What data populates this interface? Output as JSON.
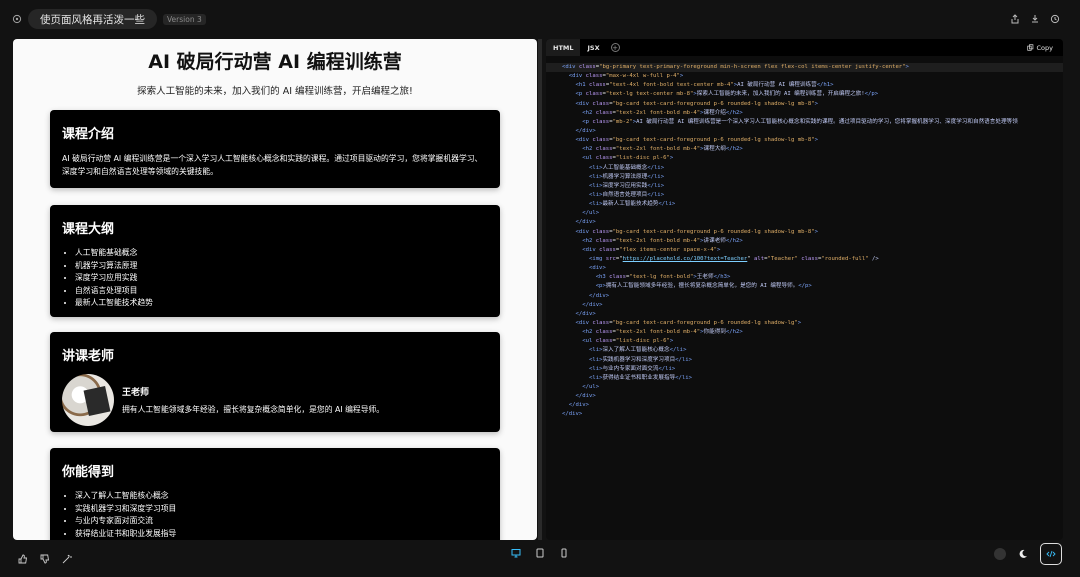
{
  "header": {
    "title": "使页面风格再活泼一些",
    "version": "Version 3"
  },
  "preview": {
    "title": "AI 破局行动营 AI 编程训练营",
    "subtitle": "探索人工智能的未来，加入我们的 AI 编程训练营，开启编程之旅!",
    "intro": {
      "heading": "课程介绍",
      "body": "AI 破局行动营 AI 编程训练营是一个深入学习人工智能核心概念和实践的课程。通过项目驱动的学习，您将掌握机器学习、深度学习和自然语言处理等领域的关键技能。"
    },
    "outline": {
      "heading": "课程大纲",
      "items": [
        "人工智能基础概念",
        "机器学习算法原理",
        "深度学习应用实践",
        "自然语言处理项目",
        "最新人工智能技术趋势"
      ]
    },
    "teacher": {
      "heading": "讲课老师",
      "name": "王老师",
      "bio": "拥有人工智能领域多年经验，擅长将复杂概念简单化，是您的 AI 编程导师。"
    },
    "gains": {
      "heading": "你能得到",
      "items": [
        "深入了解人工智能核心概念",
        "实践机器学习和深度学习项目",
        "与业内专家面对面交流",
        "获得结业证书和职业发展指导"
      ]
    }
  },
  "code": {
    "tabs": [
      "HTML",
      "JSX"
    ],
    "copy_label": "Copy",
    "lines": [
      "<div class=\"bg-primary text-primary-foreground min-h-screen flex flex-col items-center justify-center\">",
      "  <div class=\"max-w-4xl w-full p-4\">",
      "    <h1 class=\"text-4xl font-bold text-center mb-4\">AI 破局行动营 AI 编程训练营</h1>",
      "    <p class=\"text-lg text-center mb-8\">探索人工智能的未来，加入我们的 AI 编程训练营，开启编程之旅!</p>",
      "    <div class=\"bg-card text-card-foreground p-6 rounded-lg shadow-lg mb-8\">",
      "      <h2 class=\"text-2xl font-bold mb-4\">课程介绍</h2>",
      "      <p class=\"mb-2\">AI 破局行动营 AI 编程训练营是一个深入学习人工智能核心概念和实践的课程。通过项目驱动的学习，您将掌握机器学习、深度学习和自然语言处理等领",
      "    </div>",
      "    <div class=\"bg-card text-card-foreground p-6 rounded-lg shadow-lg mb-8\">",
      "      <h2 class=\"text-2xl font-bold mb-4\">课程大纲</h2>",
      "      <ul class=\"list-disc pl-6\">",
      "        <li>人工智能基础概念</li>",
      "        <li>机器学习算法原理</li>",
      "        <li>深度学习应用实践</li>",
      "        <li>自然语言处理项目</li>",
      "        <li>最新人工智能技术趋势</li>",
      "      </ul>",
      "    </div>",
      "    <div class=\"bg-card text-card-foreground p-6 rounded-lg shadow-lg mb-8\">",
      "      <h2 class=\"text-2xl font-bold mb-4\">讲课老师</h2>",
      "      <div class=\"flex items-center space-x-4\">",
      "        <img src=\"https://placehold.co/100?text=Teacher\" alt=\"Teacher\" class=\"rounded-full\" />",
      "        <div>",
      "          <h3 class=\"text-lg font-bold\">王老师</h3>",
      "          <p>拥有人工智能领域多年经验，擅长将复杂概念简单化，是您的 AI 编程导师。</p>",
      "        </div>",
      "      </div>",
      "    </div>",
      "    <div class=\"bg-card text-card-foreground p-6 rounded-lg shadow-lg\">",
      "      <h2 class=\"text-2xl font-bold mb-4\">你能得到</h2>",
      "      <ul class=\"list-disc pl-6\">",
      "        <li>深入了解人工智能核心概念</li>",
      "        <li>实践机器学习和深度学习项目</li>",
      "        <li>与业内专家面对面交流</li>",
      "        <li>获得结业证书和职业发展指导</li>",
      "      </ul>",
      "    </div>",
      "  </div>",
      "</div>"
    ]
  },
  "icons": {
    "header_left": "settings-icon",
    "header_right": [
      "share-icon",
      "download-icon",
      "history-icon"
    ],
    "bottom_left": [
      "thumbs-up-icon",
      "thumbs-down-icon",
      "magic-wand-icon"
    ],
    "bottom_center": [
      "desktop-icon",
      "tablet-icon",
      "mobile-icon"
    ],
    "bottom_right": [
      "theme-circle-icon",
      "moon-icon",
      "code-icon"
    ]
  },
  "colors": {
    "accent_blue": "#38bdf8",
    "card_bg": "#000000",
    "preview_bg": "#fafafa"
  }
}
